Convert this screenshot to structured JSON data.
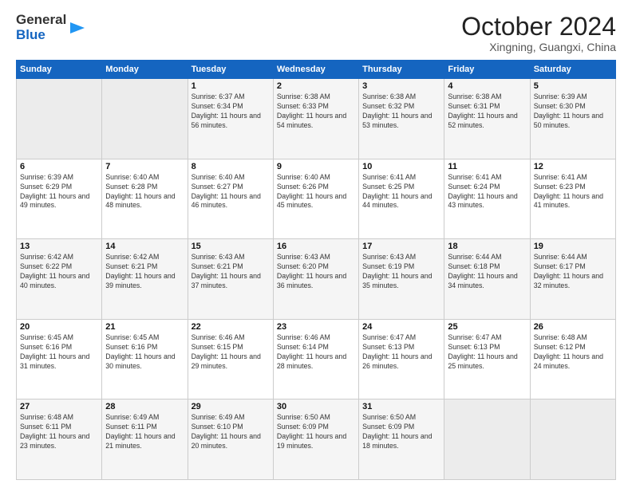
{
  "logo": {
    "line1": "General",
    "line2": "Blue"
  },
  "title": "October 2024",
  "location": "Xingning, Guangxi, China",
  "days_header": [
    "Sunday",
    "Monday",
    "Tuesday",
    "Wednesday",
    "Thursday",
    "Friday",
    "Saturday"
  ],
  "weeks": [
    [
      {
        "num": "",
        "info": ""
      },
      {
        "num": "",
        "info": ""
      },
      {
        "num": "1",
        "info": "Sunrise: 6:37 AM\nSunset: 6:34 PM\nDaylight: 11 hours and 56 minutes."
      },
      {
        "num": "2",
        "info": "Sunrise: 6:38 AM\nSunset: 6:33 PM\nDaylight: 11 hours and 54 minutes."
      },
      {
        "num": "3",
        "info": "Sunrise: 6:38 AM\nSunset: 6:32 PM\nDaylight: 11 hours and 53 minutes."
      },
      {
        "num": "4",
        "info": "Sunrise: 6:38 AM\nSunset: 6:31 PM\nDaylight: 11 hours and 52 minutes."
      },
      {
        "num": "5",
        "info": "Sunrise: 6:39 AM\nSunset: 6:30 PM\nDaylight: 11 hours and 50 minutes."
      }
    ],
    [
      {
        "num": "6",
        "info": "Sunrise: 6:39 AM\nSunset: 6:29 PM\nDaylight: 11 hours and 49 minutes."
      },
      {
        "num": "7",
        "info": "Sunrise: 6:40 AM\nSunset: 6:28 PM\nDaylight: 11 hours and 48 minutes."
      },
      {
        "num": "8",
        "info": "Sunrise: 6:40 AM\nSunset: 6:27 PM\nDaylight: 11 hours and 46 minutes."
      },
      {
        "num": "9",
        "info": "Sunrise: 6:40 AM\nSunset: 6:26 PM\nDaylight: 11 hours and 45 minutes."
      },
      {
        "num": "10",
        "info": "Sunrise: 6:41 AM\nSunset: 6:25 PM\nDaylight: 11 hours and 44 minutes."
      },
      {
        "num": "11",
        "info": "Sunrise: 6:41 AM\nSunset: 6:24 PM\nDaylight: 11 hours and 43 minutes."
      },
      {
        "num": "12",
        "info": "Sunrise: 6:41 AM\nSunset: 6:23 PM\nDaylight: 11 hours and 41 minutes."
      }
    ],
    [
      {
        "num": "13",
        "info": "Sunrise: 6:42 AM\nSunset: 6:22 PM\nDaylight: 11 hours and 40 minutes."
      },
      {
        "num": "14",
        "info": "Sunrise: 6:42 AM\nSunset: 6:21 PM\nDaylight: 11 hours and 39 minutes."
      },
      {
        "num": "15",
        "info": "Sunrise: 6:43 AM\nSunset: 6:21 PM\nDaylight: 11 hours and 37 minutes."
      },
      {
        "num": "16",
        "info": "Sunrise: 6:43 AM\nSunset: 6:20 PM\nDaylight: 11 hours and 36 minutes."
      },
      {
        "num": "17",
        "info": "Sunrise: 6:43 AM\nSunset: 6:19 PM\nDaylight: 11 hours and 35 minutes."
      },
      {
        "num": "18",
        "info": "Sunrise: 6:44 AM\nSunset: 6:18 PM\nDaylight: 11 hours and 34 minutes."
      },
      {
        "num": "19",
        "info": "Sunrise: 6:44 AM\nSunset: 6:17 PM\nDaylight: 11 hours and 32 minutes."
      }
    ],
    [
      {
        "num": "20",
        "info": "Sunrise: 6:45 AM\nSunset: 6:16 PM\nDaylight: 11 hours and 31 minutes."
      },
      {
        "num": "21",
        "info": "Sunrise: 6:45 AM\nSunset: 6:16 PM\nDaylight: 11 hours and 30 minutes."
      },
      {
        "num": "22",
        "info": "Sunrise: 6:46 AM\nSunset: 6:15 PM\nDaylight: 11 hours and 29 minutes."
      },
      {
        "num": "23",
        "info": "Sunrise: 6:46 AM\nSunset: 6:14 PM\nDaylight: 11 hours and 28 minutes."
      },
      {
        "num": "24",
        "info": "Sunrise: 6:47 AM\nSunset: 6:13 PM\nDaylight: 11 hours and 26 minutes."
      },
      {
        "num": "25",
        "info": "Sunrise: 6:47 AM\nSunset: 6:13 PM\nDaylight: 11 hours and 25 minutes."
      },
      {
        "num": "26",
        "info": "Sunrise: 6:48 AM\nSunset: 6:12 PM\nDaylight: 11 hours and 24 minutes."
      }
    ],
    [
      {
        "num": "27",
        "info": "Sunrise: 6:48 AM\nSunset: 6:11 PM\nDaylight: 11 hours and 23 minutes."
      },
      {
        "num": "28",
        "info": "Sunrise: 6:49 AM\nSunset: 6:11 PM\nDaylight: 11 hours and 21 minutes."
      },
      {
        "num": "29",
        "info": "Sunrise: 6:49 AM\nSunset: 6:10 PM\nDaylight: 11 hours and 20 minutes."
      },
      {
        "num": "30",
        "info": "Sunrise: 6:50 AM\nSunset: 6:09 PM\nDaylight: 11 hours and 19 minutes."
      },
      {
        "num": "31",
        "info": "Sunrise: 6:50 AM\nSunset: 6:09 PM\nDaylight: 11 hours and 18 minutes."
      },
      {
        "num": "",
        "info": ""
      },
      {
        "num": "",
        "info": ""
      }
    ]
  ]
}
